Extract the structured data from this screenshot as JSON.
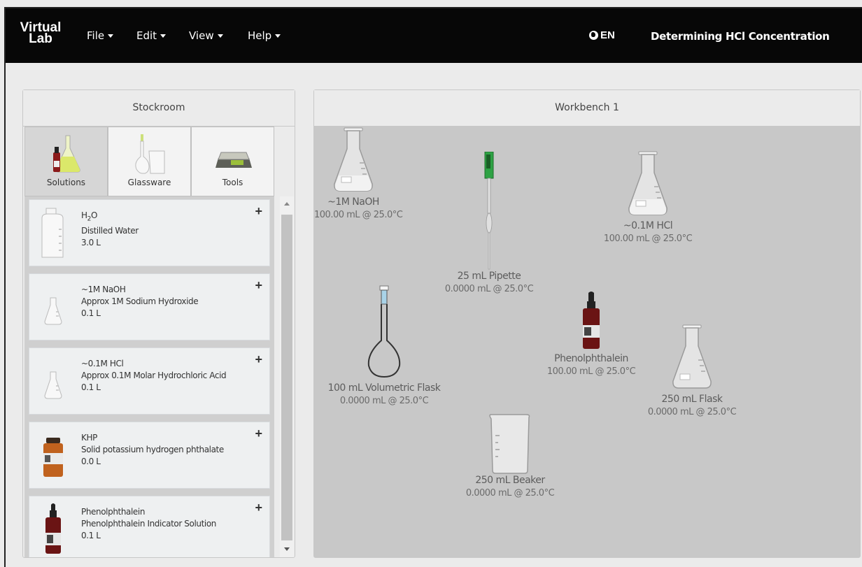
{
  "app": {
    "brand_line1": "Virtual",
    "brand_line2": "Lab",
    "language": "EN",
    "assignment_title": "Determining HCl Concentration"
  },
  "menu": [
    {
      "label": "File"
    },
    {
      "label": "Edit"
    },
    {
      "label": "View"
    },
    {
      "label": "Help"
    }
  ],
  "stockroom": {
    "title": "Stockroom",
    "tabs": [
      {
        "label": "Solutions",
        "icon": "solutions-icon",
        "active": true
      },
      {
        "label": "Glassware",
        "icon": "glassware-icon",
        "active": false
      },
      {
        "label": "Tools",
        "icon": "tools-icon",
        "active": false
      }
    ],
    "items": [
      {
        "formula_base": "H",
        "formula_sub": "2",
        "formula_rest": "O",
        "description": "Distilled Water",
        "volume": "3.0 L",
        "icon": "water-jug-icon",
        "add": "+"
      },
      {
        "name": "~1M NaOH",
        "description": "Approx 1M Sodium Hydroxide",
        "volume": "0.1 L",
        "icon": "flask-icon",
        "add": "+"
      },
      {
        "name": "~0.1M HCl",
        "description": "Approx 0.1M Molar Hydrochloric Acid",
        "volume": "0.1 L",
        "icon": "flask-icon",
        "add": "+"
      },
      {
        "name": "KHP",
        "description": "Solid potassium hydrogen phthalate",
        "volume": "0.0 L",
        "icon": "jar-icon",
        "add": "+"
      },
      {
        "name": "Phenolphthalein",
        "description": "Phenolphthalein Indicator Solution",
        "volume": "0.1 L",
        "icon": "dropper-bottle-icon",
        "add": "+"
      }
    ]
  },
  "workbench": {
    "title": "Workbench 1",
    "items": [
      {
        "name": "~1M NaOH",
        "state": "100.00 mL @ 25.0°C",
        "icon": "erlenmeyer-flask-icon"
      },
      {
        "name": "25 mL Pipette",
        "state": "0.0000 mL @ 25.0°C",
        "icon": "pipette-icon"
      },
      {
        "name": "~0.1M HCl",
        "state": "100.00 mL @ 25.0°C",
        "icon": "erlenmeyer-flask-icon"
      },
      {
        "name": "100 mL Volumetric Flask",
        "state": "0.0000 mL @ 25.0°C",
        "icon": "volumetric-flask-icon"
      },
      {
        "name": "Phenolphthalein",
        "state": "100.00 mL @ 25.0°C",
        "icon": "dropper-bottle-icon"
      },
      {
        "name": "250 mL Flask",
        "state": "0.0000 mL @ 25.0°C",
        "icon": "erlenmeyer-flask-icon"
      },
      {
        "name": "250 mL Beaker",
        "state": "0.0000 mL @ 25.0°C",
        "icon": "beaker-icon"
      }
    ]
  }
}
